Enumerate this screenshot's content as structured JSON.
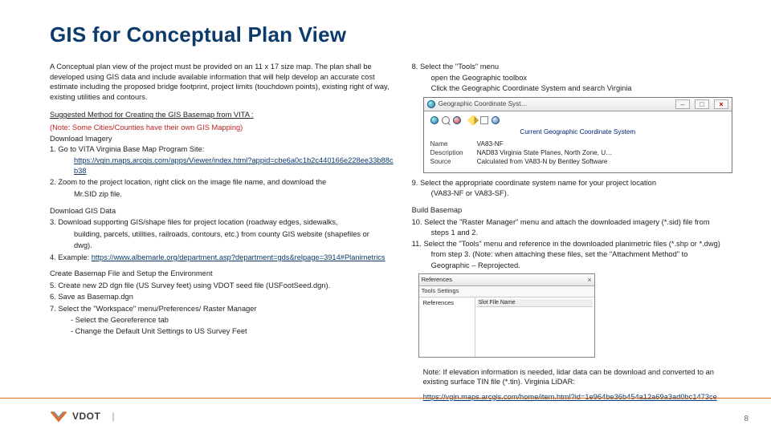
{
  "title": "GIS for Conceptual Plan View",
  "left": {
    "intro": "A Conceptual plan view of the project must be provided on an 11 x 17 size map.  The plan shall be developed using GIS data and include available information that will help develop an accurate cost estimate including the proposed bridge footprint, project limits (touchdown points), existing right of way, existing utilities and contours.",
    "suggested_heading": "Suggested Method for Creating the GIS Basemap from VITA :",
    "note_red": "(Note: Some Cities/Counties have their own GIS Mapping)",
    "download_imagery": "Download Imagery",
    "item1": "1.   Go to VITA Virginia Base Map Program Site:",
    "link1": "https://vgin.maps.arcgis.com/apps/Viewer/index.html?appid=cbe6a0c1b2c440166e228ee33b88cb38",
    "item2a": "2.   Zoom to the project location, right click on the image file name, and download the",
    "item2b": "Mr.SID zip file.",
    "download_gis": "Download GIS Data",
    "item3a": "3.   Download supporting GIS/shape files for project location (roadway edges, sidewalks,",
    "item3b": "building, parcels, utilities, railroads, contours, etc.) from county GIS website (shapefiles or",
    "item3c": "dwg).",
    "item4_pre": "4.   Example: ",
    "link2": "https://www.albemarle.org/department.asp?department=gds&relpage=3914#Planimetrics",
    "create_basemap": "Create Basemap File and Setup the Environment",
    "item5": "5.   Create new 2D dgn file (US Survey feet) using VDOT seed file (USFootSeed.dgn).",
    "item6": "6.   Save as Basemap.dgn",
    "item7": "7.   Select the \"Workspace\" menu/Preferences/ Raster Manager",
    "item7a": "- Select the Georeference tab",
    "item7b": "- Change the Default Unit Settings to US Survey Feet"
  },
  "right": {
    "item8": "8. Select the \"Tools\" menu",
    "item8a": "open the Geographic toolbox",
    "item8b": "Click the Geographic Coordinate System and search Virginia",
    "win1": {
      "title": "Geographic Coordinate Syst…",
      "section": "Current Geographic Coordinate System",
      "k1": "Name",
      "v1": "VA83-NF",
      "k2": "Description",
      "v2": "NAD83 Virginia State Planes, North Zone, U…",
      "k3": "Source",
      "v3": "Calculated from VA83-N by Bentley Software"
    },
    "item9a": "9.  Select the appropriate coordinate system name for your project location",
    "item9b": "(VA83-NF or VA83-SF).",
    "build": "Build Basemap",
    "item10a": "10. Select the \"Raster Manager\" menu and attach the downloaded imagery (*.sid) file from",
    "item10b": "steps 1 and 2.",
    "item11a": "11. Select the \"Tools\" menu and reference in the downloaded planimetric files (*.shp or *.dwg)",
    "item11b": "from step 3. (Note: when attaching these files, set the \"Attachment Method\" to",
    "item11c": "Geographic – Reprojected.",
    "win2": {
      "title": "References",
      "menu": "Tools   Settings",
      "treehead": "References",
      "cols": "Slot   File Name"
    },
    "note": "Note: If elevation information is needed, lidar data can be download and converted to an existing surface TIN file (*.tin). Virginia LiDAR:",
    "link3": "https://vgin.maps.arcgis.com/home/item.html?id=1e964be36b454a12a69a3ad0bc1473ce"
  },
  "footer": {
    "brand": "VDOT",
    "sep": "|",
    "page": "8"
  }
}
